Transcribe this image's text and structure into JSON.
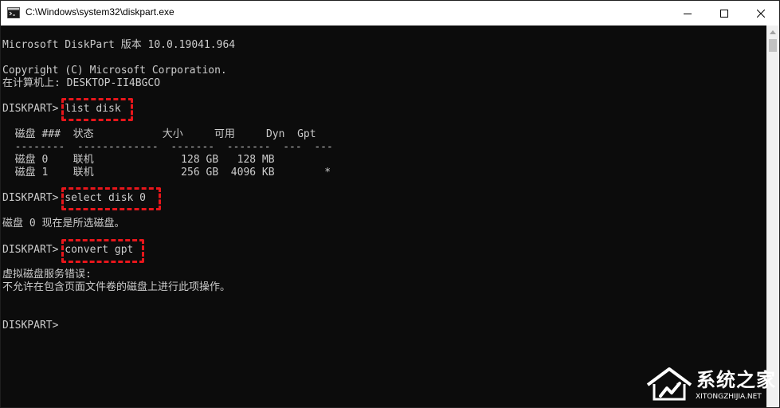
{
  "window": {
    "title": "C:\\Windows\\system32\\diskpart.exe",
    "icons": {
      "app": "console-app-icon",
      "minimize": "minimize-icon",
      "maximize": "maximize-icon",
      "close": "close-icon"
    }
  },
  "console": {
    "lines": [
      "Microsoft DiskPart 版本 10.0.19041.964",
      "Copyright (C) Microsoft Corporation.",
      "在计算机上: DESKTOP-II4BGCO",
      "DISKPART> list disk",
      "  磁盘 ###  状态           大小     可用     Dyn  Gpt",
      "  --------  -------------  -------  -------  ---  ---",
      "  磁盘 0    联机              128 GB   128 MB",
      "  磁盘 1    联机              256 GB  4096 KB        *",
      "DISKPART> select disk 0",
      "磁盘 0 现在是所选磁盘。",
      "DISKPART> convert gpt",
      "虚拟磁盘服务错误:",
      "不允许在包含页面文件卷的磁盘上进行此项操作。",
      "DISKPART>"
    ],
    "highlighted_commands": [
      "list disk",
      "select disk 0",
      "convert gpt"
    ]
  },
  "watermark": {
    "text": "系统之家",
    "subtext": "XITONGZHIJIA.NET"
  },
  "colors": {
    "console_bg": "#0c0c0c",
    "console_text": "#cccccc",
    "highlight": "#e8161b",
    "titlebar_bg": "#ffffff"
  }
}
